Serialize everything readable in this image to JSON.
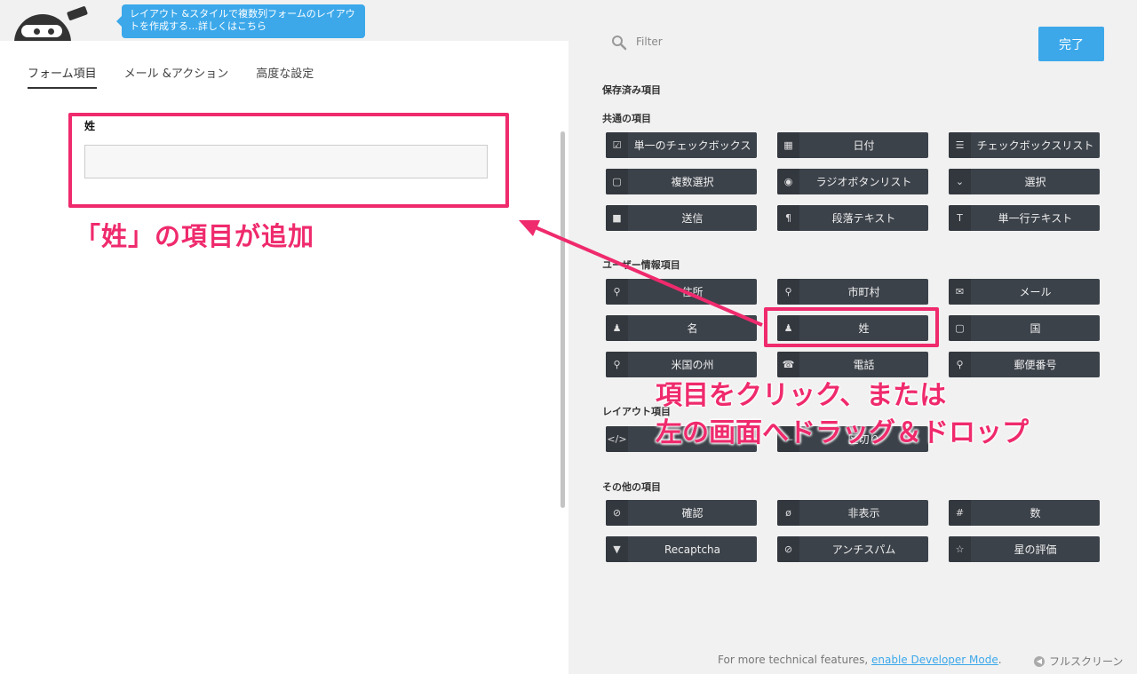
{
  "tooltip": "レイアウト &スタイルで複数列フォームのレイアウトを作成する…詳しくはこちら",
  "tabs": [
    "フォーム項目",
    "メール &アクション",
    "高度な設定"
  ],
  "form": {
    "field_label": "姓"
  },
  "annotations": {
    "left": "「姓」の項目が追加",
    "right_line1": "項目をクリック、または",
    "right_line2": "左の画面へドラッグ＆ドロップ"
  },
  "filter_placeholder": "Filter",
  "done_label": "完了",
  "sections": {
    "saved": "保存済み項目",
    "common": "共通の項目",
    "user": "ユーザー情報項目",
    "layout": "レイアウト項目",
    "other": "その他の項目"
  },
  "common_fields": [
    {
      "label": "単一のチェックボックス",
      "icon": "checkbox-icon"
    },
    {
      "label": "日付",
      "icon": "calendar-icon"
    },
    {
      "label": "チェックボックスリスト",
      "icon": "list-icon"
    },
    {
      "label": "複数選択",
      "icon": "square-icon"
    },
    {
      "label": "ラジオボタンリスト",
      "icon": "radio-icon"
    },
    {
      "label": "選択",
      "icon": "chevron-down-icon"
    },
    {
      "label": "送信",
      "icon": "stop-icon"
    },
    {
      "label": "段落テキスト",
      "icon": "paragraph-icon"
    },
    {
      "label": "単一行テキスト",
      "icon": "text-icon"
    }
  ],
  "user_fields": [
    {
      "label": "住所",
      "icon": "map-pin-icon"
    },
    {
      "label": "市町村",
      "icon": "map-pin-icon"
    },
    {
      "label": "メール",
      "icon": "envelope-icon"
    },
    {
      "label": "名",
      "icon": "user-icon"
    },
    {
      "label": "姓",
      "icon": "user-icon"
    },
    {
      "label": "国",
      "icon": "square-icon"
    },
    {
      "label": "米国の州",
      "icon": "map-pin-icon"
    },
    {
      "label": "電話",
      "icon": "phone-icon"
    },
    {
      "label": "郵便番号",
      "icon": "map-pin-icon"
    }
  ],
  "layout_fields": [
    {
      "label": "",
      "icon": "code-icon"
    },
    {
      "label": "区切り",
      "icon": "divider-icon"
    }
  ],
  "other_fields": [
    {
      "label": "確認",
      "icon": "check-circle-icon"
    },
    {
      "label": "非表示",
      "icon": "eye-slash-icon"
    },
    {
      "label": "数",
      "icon": "hash-icon"
    },
    {
      "label": "Recaptcha",
      "icon": "filter-icon"
    },
    {
      "label": "アンチスパム",
      "icon": "ban-icon"
    },
    {
      "label": "星の評価",
      "icon": "star-icon"
    }
  ],
  "footer": {
    "text": "For more technical features,",
    "link": "enable Developer Mode",
    "suffix": "."
  },
  "fullscreen_label": "フルスクリーン"
}
